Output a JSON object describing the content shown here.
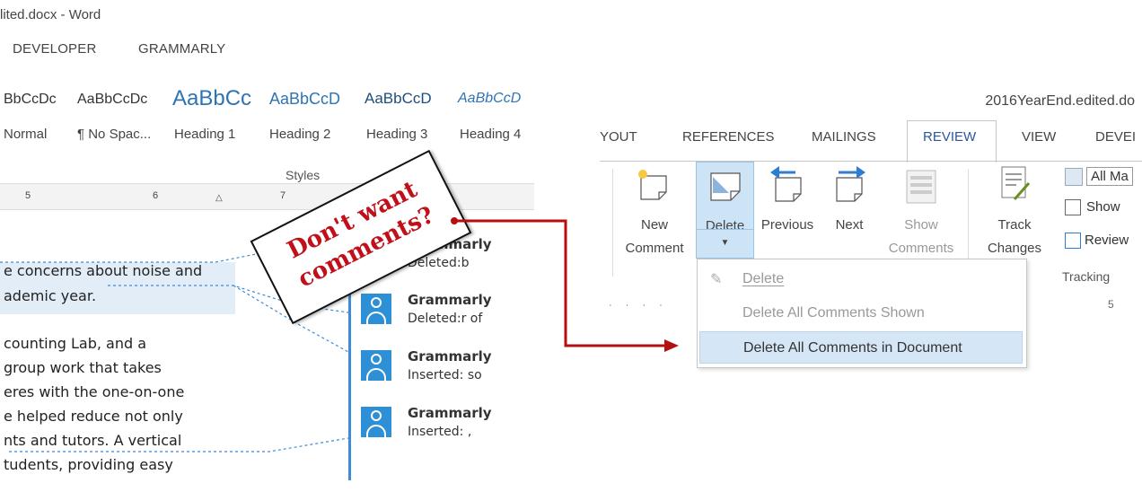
{
  "left": {
    "title": "lited.docx - Word",
    "tabs": [
      "DEVELOPER",
      "GRAMMARLY"
    ],
    "styles": [
      {
        "sample": "BbCcDc",
        "name": "Normal"
      },
      {
        "sample": "AaBbCcDc",
        "name": "¶ No Spac..."
      },
      {
        "sample": "AaBbCc",
        "name": "Heading 1"
      },
      {
        "sample": "AaBbCcD",
        "name": "Heading 2"
      },
      {
        "sample": "AaBbCcD",
        "name": "Heading 3"
      },
      {
        "sample": "AaBbCcD",
        "name": "Heading 4"
      }
    ],
    "styles_label": "Styles",
    "ruler": {
      "m5": "5",
      "m6": "6",
      "m7": "7"
    },
    "doc_lines": [
      "e concerns about noise and",
      "ademic year.",
      "counting Lab, and a",
      "group work that takes",
      "eres with the one-on-one",
      "e helped reduce not only",
      "nts and tutors. A vertical",
      "tudents, providing easy"
    ],
    "comments": [
      {
        "author": "Grammarly",
        "text": "Deleted:b"
      },
      {
        "author": "Grammarly",
        "text": "Deleted:r of"
      },
      {
        "author": "Grammarly",
        "text": "Inserted: so"
      },
      {
        "author": "Grammarly",
        "text": "Inserted: ,"
      }
    ]
  },
  "callout": {
    "line1": "Don't want",
    "line2": "comments?"
  },
  "right": {
    "doc_title": "2016YearEnd.edited.do",
    "tabs": [
      "YOUT",
      "REFERENCES",
      "MAILINGS",
      "REVIEW",
      "VIEW",
      "DEVEI"
    ],
    "buttons": {
      "new_comment": [
        "New",
        "Comment"
      ],
      "delete": "Delete",
      "previous": "Previous",
      "next": "Next",
      "show_comments": [
        "Show",
        "Comments"
      ],
      "track_changes": [
        "Track",
        "Changes"
      ]
    },
    "side_items": [
      "All Ma",
      "Show",
      "Review"
    ],
    "tracking_label": "Tracking",
    "ruler_mark": "5",
    "dropdown": [
      "Delete",
      "Delete All Comments Shown",
      "Delete All Comments in Document"
    ]
  },
  "colors": {
    "accent_blue": "#2d8fd5",
    "callout_red": "#c0101a",
    "arrow_red": "#b50f0f",
    "highlight": "#d5e6f7"
  }
}
